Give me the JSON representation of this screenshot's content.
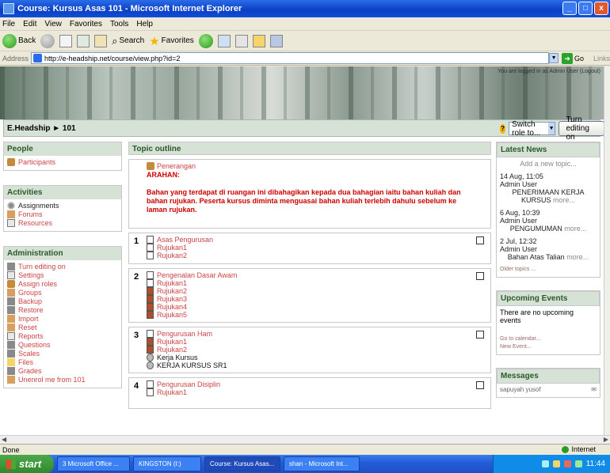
{
  "window": {
    "title": "Course: Kursus Asas 101 - Microsoft Internet Explorer",
    "controls": [
      "_",
      "□",
      "x"
    ]
  },
  "menu": [
    "File",
    "Edit",
    "View",
    "Favorites",
    "Tools",
    "Help"
  ],
  "toolbar": {
    "back": "Back",
    "search": "Search",
    "favorites": "Favorites"
  },
  "address": {
    "label": "Address",
    "url": "http://e-headship.net/course/view.php?id=2",
    "go": "Go",
    "links": "Links"
  },
  "page": {
    "login_info": "You are logged in as Admin User (Logout)",
    "breadcrumb": "E.Headship ► 101",
    "role_select": "Switch role to...",
    "edit_button": "Turn editing on"
  },
  "left": {
    "people": {
      "title": "People",
      "items": [
        "Participants"
      ]
    },
    "activities": {
      "title": "Activities",
      "items": [
        "Assignments",
        "Forums",
        "Resources"
      ]
    },
    "administration": {
      "title": "Administration",
      "items": [
        "Turn editing on",
        "Settings",
        "Assign roles",
        "Groups",
        "Backup",
        "Restore",
        "Import",
        "Reset",
        "Reports",
        "Questions",
        "Scales",
        "Files",
        "Grades",
        "Unenrol me from 101"
      ]
    }
  },
  "center": {
    "title": "Topic outline",
    "intro": {
      "resource": "Penerangan",
      "arahan": "ARAHAN:",
      "text": "Bahan yang terdapat di ruangan ini dibahagikan kepada dua bahagian iaitu bahan kuliah dan bahan rujukan. Peserta kursus diminta menguasai bahan kuliah terlebih dahulu sebelum ke laman rujukan."
    },
    "sections": [
      {
        "num": "1",
        "items": [
          "Asas Pengurusan",
          "Rujukan1",
          "Rujukan2"
        ]
      },
      {
        "num": "2",
        "items": [
          "Pengenalan Dasar Awam",
          "Rujukan1",
          "Rujukan2",
          "Rujukan3",
          "Rujukan4",
          "Rujukan5"
        ]
      },
      {
        "num": "3",
        "items": [
          "Pengurusan Ham",
          "Rujukan1",
          "Rujukan2",
          "Kerja Kursus",
          "KERJA KURSUS SR1"
        ]
      },
      {
        "num": "4",
        "items": [
          "Pengurusan Disiplin",
          "Rujukan1"
        ]
      }
    ]
  },
  "right": {
    "news": {
      "title": "Latest News",
      "add": "Add a new topic...",
      "items": [
        {
          "date": "14 Aug, 11:05",
          "author": "Admin User",
          "text": "PENERIMAAN KERJA KURSUS",
          "more": "more..."
        },
        {
          "date": "6 Aug, 10:39",
          "author": "Admin User",
          "text": "PENGUMUMAN",
          "more": "more..."
        },
        {
          "date": "2 Jul, 12:32",
          "author": "Admin User",
          "text": "Bahan Atas Talian",
          "more": "more..."
        }
      ],
      "older": "Older topics ..."
    },
    "events": {
      "title": "Upcoming Events",
      "text": "There are no upcoming events",
      "calendar": "Go to calendar...",
      "new_event": "New Event..."
    },
    "messages": {
      "title": "Messages",
      "item": "sapuyah yusof"
    }
  },
  "status": {
    "text": "Done",
    "zone": "Internet"
  },
  "taskbar": {
    "start": "start",
    "tasks": [
      "3 Microsoft Office ...",
      "KINGSTON (I:)",
      "Course: Kursus Asas...",
      "shan - Microsoft Int..."
    ],
    "clock": "11:44"
  }
}
